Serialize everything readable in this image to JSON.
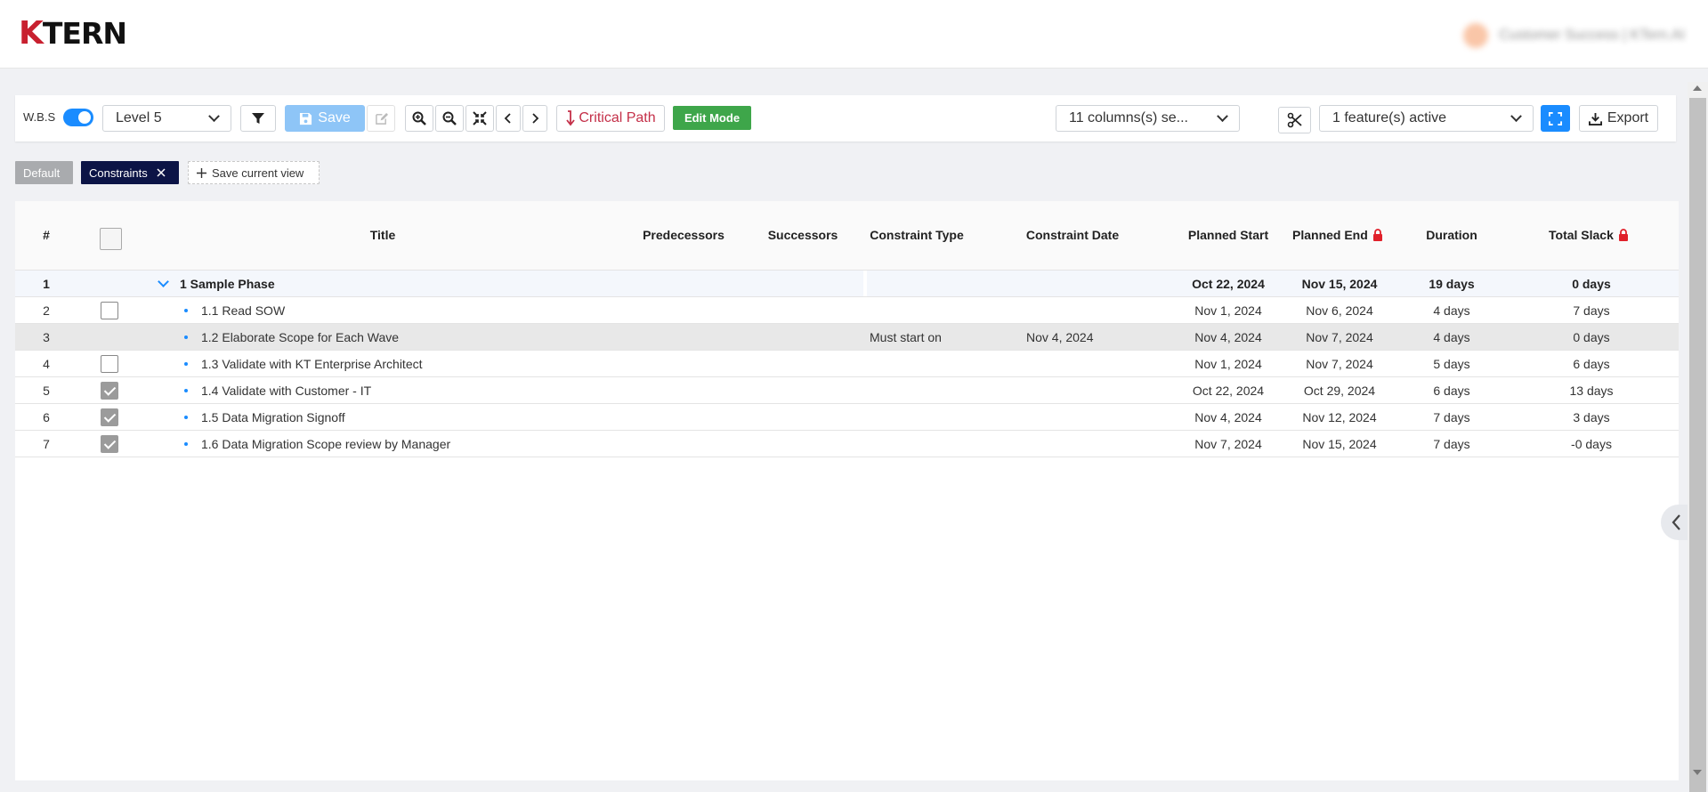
{
  "app": {
    "logo_k": "K",
    "logo_rest": "TERN",
    "user_name": "Customer Success | KTern.AI"
  },
  "toolbar": {
    "wbs_label": "W.B.S",
    "level": "Level 5",
    "save_label": "Save",
    "critical_path_label": "Critical Path",
    "edit_mode_label": "Edit Mode",
    "columns_select": "11 columns(s) se...",
    "features_select": "1 feature(s) active",
    "export_label": "Export"
  },
  "views": {
    "default": "Default",
    "constraints": "Constraints",
    "save_current": "Save current view"
  },
  "columns": {
    "num": "#",
    "title": "Title",
    "predecessors": "Predecessors",
    "successors": "Successors",
    "constraint_type": "Constraint Type",
    "constraint_date": "Constraint Date",
    "planned_start": "Planned Start",
    "planned_end": "Planned End",
    "duration": "Duration",
    "total_slack": "Total Slack"
  },
  "rows": [
    {
      "num": "1",
      "title": "1 Sample Phase",
      "constraint_type": "",
      "constraint_date": "",
      "start": "Oct 22, 2024",
      "end": "Nov 15, 2024",
      "duration": "19 days",
      "slack": "0 days"
    },
    {
      "num": "2",
      "title": "1.1 Read SOW",
      "constraint_type": "",
      "constraint_date": "",
      "start": "Nov 1, 2024",
      "end": "Nov 6, 2024",
      "duration": "4 days",
      "slack": "7 days"
    },
    {
      "num": "3",
      "title": "1.2 Elaborate Scope for Each Wave",
      "constraint_type": "Must start on",
      "constraint_date": "Nov 4, 2024",
      "start": "Nov 4, 2024",
      "end": "Nov 7, 2024",
      "duration": "4 days",
      "slack": "0 days"
    },
    {
      "num": "4",
      "title": "1.3 Validate with KT Enterprise Architect",
      "constraint_type": "",
      "constraint_date": "",
      "start": "Nov 1, 2024",
      "end": "Nov 7, 2024",
      "duration": "5 days",
      "slack": "6 days"
    },
    {
      "num": "5",
      "title": "1.4 Validate with Customer - IT",
      "constraint_type": "",
      "constraint_date": "",
      "start": "Oct 22, 2024",
      "end": "Oct 29, 2024",
      "duration": "6 days",
      "slack": "13 days"
    },
    {
      "num": "6",
      "title": "1.5 Data Migration Signoff",
      "constraint_type": "",
      "constraint_date": "",
      "start": "Nov 4, 2024",
      "end": "Nov 12, 2024",
      "duration": "7 days",
      "slack": "3 days"
    },
    {
      "num": "7",
      "title": "1.6 Data Migration Scope review by Manager",
      "constraint_type": "",
      "constraint_date": "",
      "start": "Nov 7, 2024",
      "end": "Nov 15, 2024",
      "duration": "7 days",
      "slack": "-0 days"
    }
  ],
  "row_checked": [
    false,
    false,
    false,
    true,
    true,
    true
  ],
  "colors": {
    "accent": "#1a8cff",
    "critical": "#c42f48",
    "edit_mode": "#3ea64a",
    "chip_active": "#0c1446",
    "lock": "#e0202a"
  }
}
